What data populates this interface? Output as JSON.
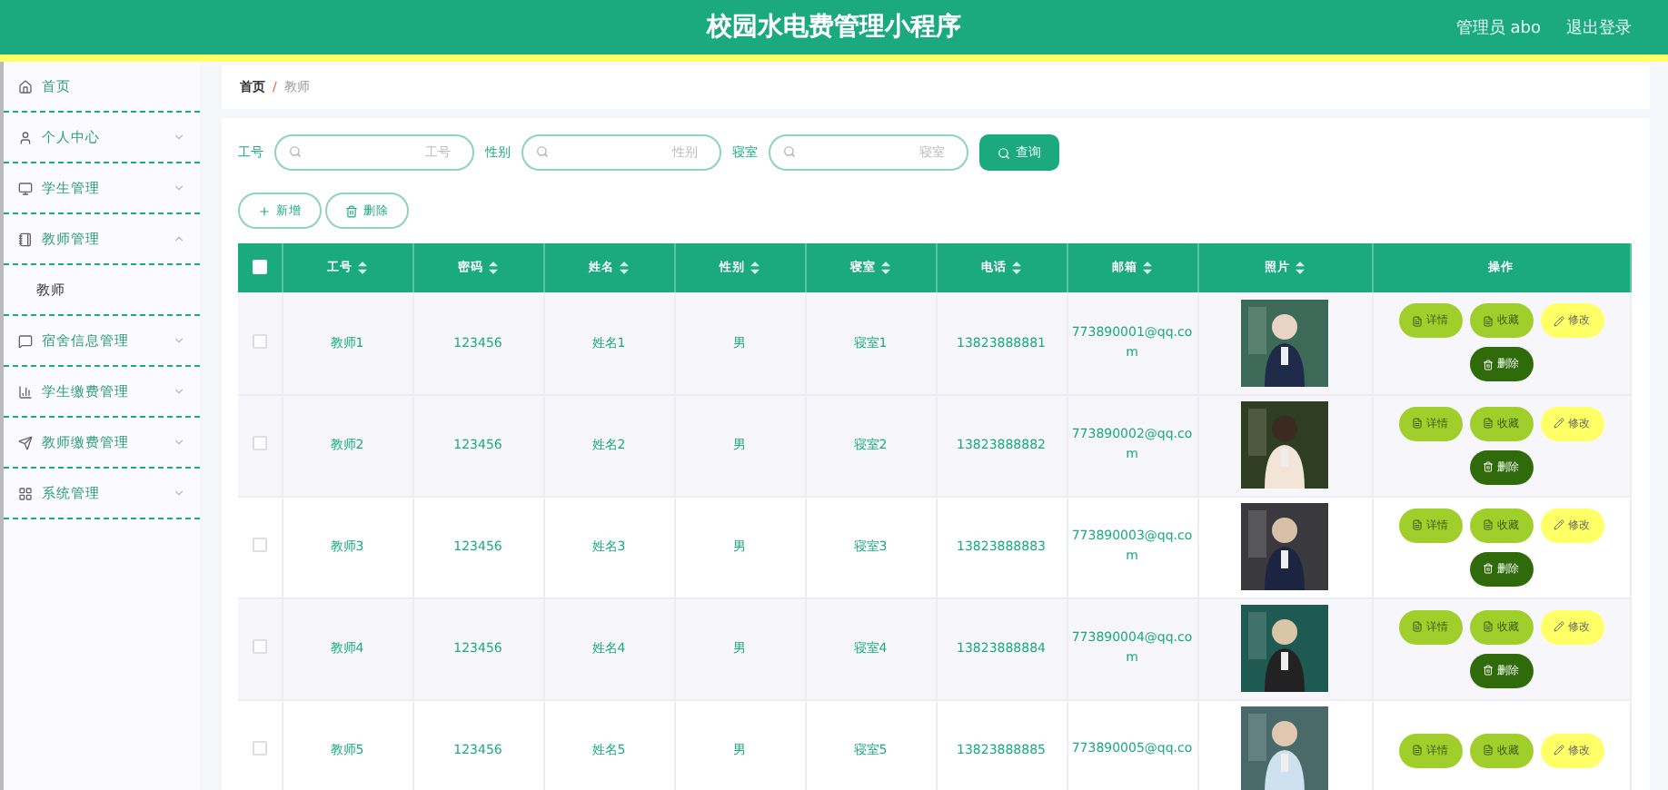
{
  "header": {
    "title": "校园水电费管理小程序",
    "user": "管理员 abo",
    "logout": "退出登录"
  },
  "sidebar": {
    "items": [
      {
        "label": "首页"
      },
      {
        "label": "个人中心",
        "expanded": false,
        "has_arrow": true
      },
      {
        "label": "学生管理",
        "expanded": false,
        "has_arrow": true
      },
      {
        "label": "教师管理",
        "expanded": true,
        "has_arrow": true,
        "children": [
          {
            "label": "教师"
          }
        ]
      },
      {
        "label": "宿舍信息管理",
        "expanded": false,
        "has_arrow": true
      },
      {
        "label": "学生缴费管理",
        "expanded": false,
        "has_arrow": true
      },
      {
        "label": "教师缴费管理",
        "expanded": false,
        "has_arrow": true
      },
      {
        "label": "系统管理",
        "expanded": false,
        "has_arrow": true
      }
    ]
  },
  "breadcrumb": {
    "items": [
      "首页",
      "教师"
    ],
    "separator": "/"
  },
  "search": {
    "fields": [
      {
        "label": "工号",
        "placeholder": "工号"
      },
      {
        "label": "性别",
        "placeholder": "性别"
      },
      {
        "label": "寝室",
        "placeholder": "寝室"
      }
    ],
    "button": "查询"
  },
  "actions": [
    "新增",
    "删除"
  ],
  "table": {
    "columns": [
      {
        "label": "工号",
        "sortable": true
      },
      {
        "label": "密码",
        "sortable": true
      },
      {
        "label": "姓名",
        "sortable": true
      },
      {
        "label": "性别",
        "sortable": true
      },
      {
        "label": "寝室",
        "sortable": true
      },
      {
        "label": "电话",
        "sortable": true
      },
      {
        "label": "邮箱",
        "sortable": true
      },
      {
        "label": "照片",
        "sortable": true
      },
      {
        "label": "操作",
        "sortable": false
      }
    ],
    "all_checked": false,
    "rows": [
      {
        "checked": false,
        "cells": [
          "教师1",
          "123456",
          "姓名1",
          "男",
          "寝室1",
          "13823888881",
          "773890001@qq.com"
        ],
        "buttons": [
          {
            "label": "详情",
            "kind": "detail"
          },
          {
            "label": "收藏",
            "kind": "favorite"
          },
          {
            "label": "修改",
            "kind": "edit"
          },
          {
            "label": "删除",
            "kind": "delete"
          }
        ]
      },
      {
        "checked": false,
        "cells": [
          "教师2",
          "123456",
          "姓名2",
          "男",
          "寝室2",
          "13823888882",
          "773890002@qq.com"
        ],
        "buttons": [
          {
            "label": "详情",
            "kind": "detail"
          },
          {
            "label": "收藏",
            "kind": "favorite"
          },
          {
            "label": "修改",
            "kind": "edit"
          },
          {
            "label": "删除",
            "kind": "delete"
          }
        ]
      },
      {
        "checked": false,
        "cells": [
          "教师3",
          "123456",
          "姓名3",
          "男",
          "寝室3",
          "13823888883",
          "773890003@qq.com"
        ],
        "buttons": [
          {
            "label": "详情",
            "kind": "detail"
          },
          {
            "label": "收藏",
            "kind": "favorite"
          },
          {
            "label": "修改",
            "kind": "edit"
          },
          {
            "label": "删除",
            "kind": "delete"
          }
        ]
      },
      {
        "checked": false,
        "cells": [
          "教师4",
          "123456",
          "姓名4",
          "男",
          "寝室4",
          "13823888884",
          "773890004@qq.com"
        ],
        "buttons": [
          {
            "label": "详情",
            "kind": "detail"
          },
          {
            "label": "收藏",
            "kind": "favorite"
          },
          {
            "label": "修改",
            "kind": "edit"
          },
          {
            "label": "删除",
            "kind": "delete"
          }
        ]
      },
      {
        "checked": false,
        "cells": [
          "教师5",
          "123456",
          "姓名5",
          "男",
          "寝室5",
          "13823888885",
          "773890005@qq.co"
        ],
        "buttons": [
          {
            "label": "详情",
            "kind": "detail"
          },
          {
            "label": "收藏",
            "kind": "favorite"
          },
          {
            "label": "修改",
            "kind": "edit"
          }
        ]
      }
    ]
  }
}
